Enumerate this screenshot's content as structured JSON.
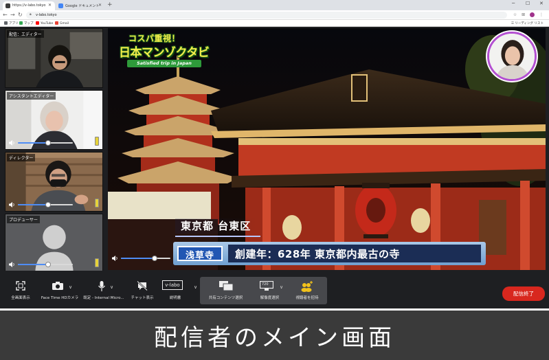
{
  "browser": {
    "tabs": [
      {
        "label": "https://v-labo.tokyo",
        "favicon_color": "#3b3b3b",
        "active": true
      },
      {
        "label": "Google ドキュメント",
        "favicon_color": "#4285f4",
        "active": false
      }
    ],
    "new_tab_glyph": "+",
    "address": "v-labo.tokyo",
    "bookmarks": [
      {
        "label": "アプリ",
        "icon_color": "#5f6368"
      },
      {
        "label": "マップ",
        "icon_color": "#34a853"
      },
      {
        "label": "YouTube",
        "icon_color": "#ff0000"
      },
      {
        "label": "Gmail",
        "icon_color": "#ea4335"
      }
    ],
    "reading_list": "リーディング リスト"
  },
  "participants": [
    {
      "label": "配信：エディター",
      "volume": 0.0,
      "has_controls": false
    },
    {
      "label": "アシスタントエディター",
      "volume": 0.55,
      "has_controls": true
    },
    {
      "label": "ディレクター",
      "volume": 0.55,
      "has_controls": true
    },
    {
      "label": "プロデューサー",
      "volume": 0.55,
      "has_controls": true
    }
  ],
  "main": {
    "logo_top": "コスパ重視！",
    "logo_main": "日本マンゾクタビ",
    "logo_sub": "Satisfied trip in Japan",
    "location": "東京都 台東区",
    "place_tag": "浅草寺",
    "place_desc": "創建年：628年 東京都内最古の寺",
    "volume": 0.68
  },
  "controls": {
    "fullscreen": "全画面表示",
    "camera": "Face Time HDカメラ",
    "mic": "既定 - Internal Micro...",
    "chat": "チャット表示",
    "manual_logo": "v-labo",
    "manual": "説明書",
    "share": "共有コンテンツ選択",
    "resolution": "解像度選択",
    "resolution_badge": "720",
    "invite": "視聴者を招待",
    "end": "配信終了"
  },
  "caption": "配信者のメイン画面",
  "colors": {
    "app_bg": "#1e1f22",
    "end_button": "#d8271e",
    "slider": "#4f8df5",
    "host_ring": "#b34fd1",
    "logo_yellow": "#f5ee4a",
    "title_navy": "#1b2d55",
    "tag_blue": "#2257b3"
  }
}
